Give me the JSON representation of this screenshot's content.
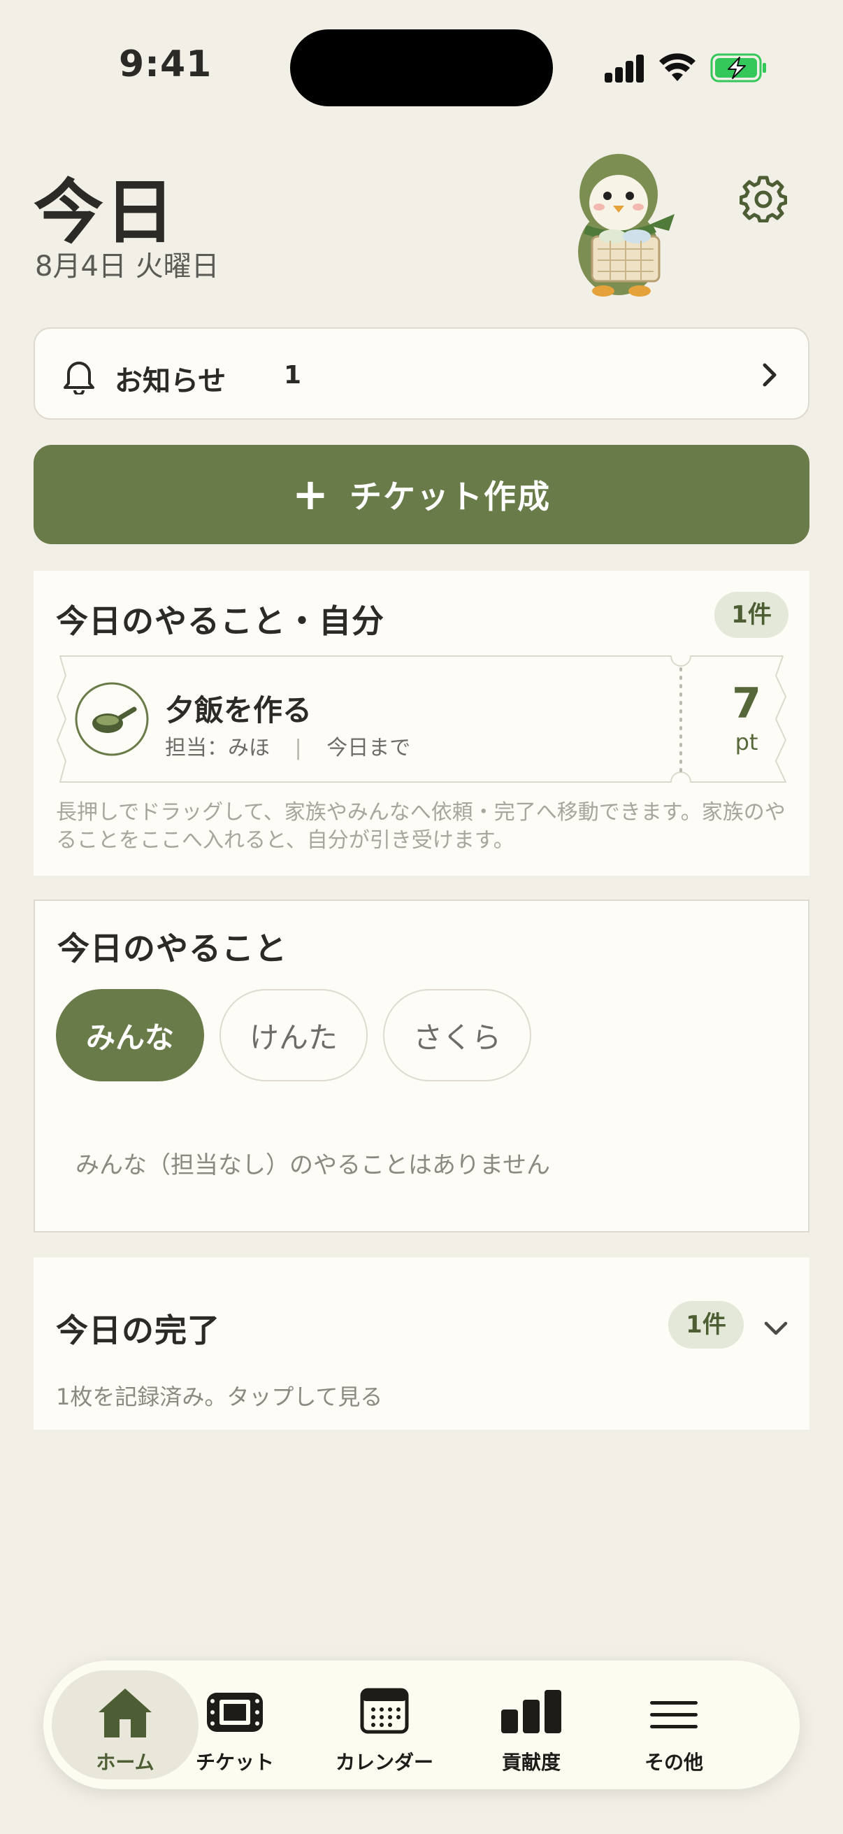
{
  "status_bar": {
    "time": "9:41"
  },
  "header": {
    "title": "今日",
    "date": "8月4日 火曜日"
  },
  "icons": {
    "settings": "gear-icon",
    "mascot": "penguin-laundry-basket",
    "notice": "bell-icon"
  },
  "notice": {
    "label": "お知らせ",
    "count": "1"
  },
  "create_button": {
    "label": "チケット作成"
  },
  "my_tasks": {
    "title": "今日のやること・自分",
    "badge": "1件",
    "ticket": {
      "name": "夕飯を作る",
      "assignee": "担当：みほ",
      "due": "今日まで",
      "points": "7",
      "points_unit": "pt"
    },
    "hint": "長押しでドラッグして、家族やみんなへ依頼・完了へ移動できます。家族のやることをここへ入れると、自分が引き受けます。"
  },
  "today_tasks": {
    "title": "今日のやること",
    "filters": [
      {
        "label": "みんな",
        "active": true
      },
      {
        "label": "けんた",
        "active": false
      },
      {
        "label": "さくら",
        "active": false
      }
    ],
    "empty_message": "みんな（担当なし）のやることはありません"
  },
  "done": {
    "title": "今日の完了",
    "badge": "1件",
    "subtitle": "1枚を記録済み。タップして見る"
  },
  "tabbar": {
    "items": [
      {
        "label": "ホーム",
        "icon": "home-icon",
        "active": true
      },
      {
        "label": "チケット",
        "icon": "ticket-icon",
        "active": false
      },
      {
        "label": "カレンダー",
        "icon": "calendar-icon",
        "active": false
      },
      {
        "label": "貢献度",
        "icon": "bar-chart-icon",
        "active": false
      },
      {
        "label": "その他",
        "icon": "menu-icon",
        "active": false
      }
    ]
  },
  "colors": {
    "background": "#f2efe6",
    "accent": "#6a7b4a",
    "card": "#fdfcf6",
    "badge_bg": "#e4e8d8",
    "battery": "#34c759"
  }
}
